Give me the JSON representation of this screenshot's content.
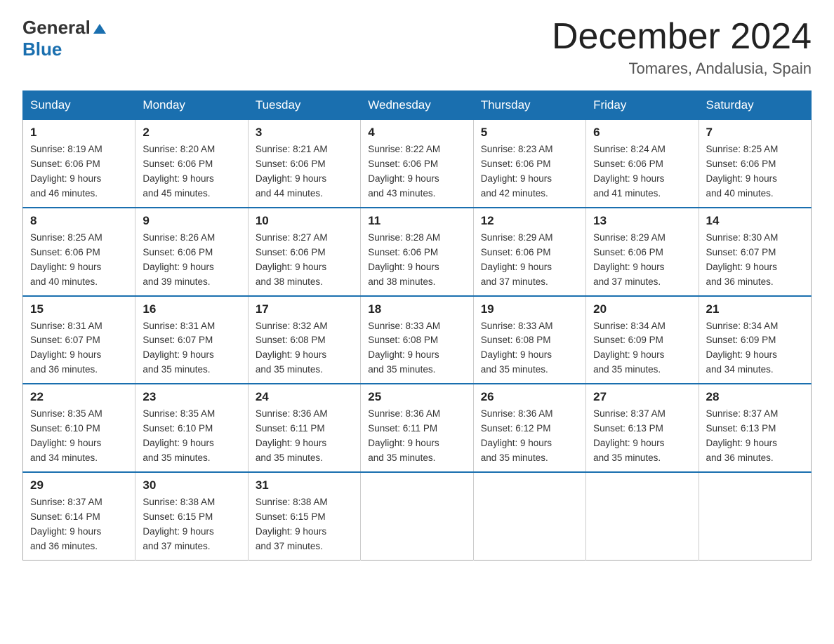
{
  "header": {
    "logo_general": "General",
    "logo_blue": "Blue",
    "month_title": "December 2024",
    "location": "Tomares, Andalusia, Spain"
  },
  "days_of_week": [
    "Sunday",
    "Monday",
    "Tuesday",
    "Wednesday",
    "Thursday",
    "Friday",
    "Saturday"
  ],
  "weeks": [
    [
      {
        "num": "1",
        "sunrise": "8:19 AM",
        "sunset": "6:06 PM",
        "daylight": "9 hours and 46 minutes."
      },
      {
        "num": "2",
        "sunrise": "8:20 AM",
        "sunset": "6:06 PM",
        "daylight": "9 hours and 45 minutes."
      },
      {
        "num": "3",
        "sunrise": "8:21 AM",
        "sunset": "6:06 PM",
        "daylight": "9 hours and 44 minutes."
      },
      {
        "num": "4",
        "sunrise": "8:22 AM",
        "sunset": "6:06 PM",
        "daylight": "9 hours and 43 minutes."
      },
      {
        "num": "5",
        "sunrise": "8:23 AM",
        "sunset": "6:06 PM",
        "daylight": "9 hours and 42 minutes."
      },
      {
        "num": "6",
        "sunrise": "8:24 AM",
        "sunset": "6:06 PM",
        "daylight": "9 hours and 41 minutes."
      },
      {
        "num": "7",
        "sunrise": "8:25 AM",
        "sunset": "6:06 PM",
        "daylight": "9 hours and 40 minutes."
      }
    ],
    [
      {
        "num": "8",
        "sunrise": "8:25 AM",
        "sunset": "6:06 PM",
        "daylight": "9 hours and 40 minutes."
      },
      {
        "num": "9",
        "sunrise": "8:26 AM",
        "sunset": "6:06 PM",
        "daylight": "9 hours and 39 minutes."
      },
      {
        "num": "10",
        "sunrise": "8:27 AM",
        "sunset": "6:06 PM",
        "daylight": "9 hours and 38 minutes."
      },
      {
        "num": "11",
        "sunrise": "8:28 AM",
        "sunset": "6:06 PM",
        "daylight": "9 hours and 38 minutes."
      },
      {
        "num": "12",
        "sunrise": "8:29 AM",
        "sunset": "6:06 PM",
        "daylight": "9 hours and 37 minutes."
      },
      {
        "num": "13",
        "sunrise": "8:29 AM",
        "sunset": "6:06 PM",
        "daylight": "9 hours and 37 minutes."
      },
      {
        "num": "14",
        "sunrise": "8:30 AM",
        "sunset": "6:07 PM",
        "daylight": "9 hours and 36 minutes."
      }
    ],
    [
      {
        "num": "15",
        "sunrise": "8:31 AM",
        "sunset": "6:07 PM",
        "daylight": "9 hours and 36 minutes."
      },
      {
        "num": "16",
        "sunrise": "8:31 AM",
        "sunset": "6:07 PM",
        "daylight": "9 hours and 35 minutes."
      },
      {
        "num": "17",
        "sunrise": "8:32 AM",
        "sunset": "6:08 PM",
        "daylight": "9 hours and 35 minutes."
      },
      {
        "num": "18",
        "sunrise": "8:33 AM",
        "sunset": "6:08 PM",
        "daylight": "9 hours and 35 minutes."
      },
      {
        "num": "19",
        "sunrise": "8:33 AM",
        "sunset": "6:08 PM",
        "daylight": "9 hours and 35 minutes."
      },
      {
        "num": "20",
        "sunrise": "8:34 AM",
        "sunset": "6:09 PM",
        "daylight": "9 hours and 35 minutes."
      },
      {
        "num": "21",
        "sunrise": "8:34 AM",
        "sunset": "6:09 PM",
        "daylight": "9 hours and 34 minutes."
      }
    ],
    [
      {
        "num": "22",
        "sunrise": "8:35 AM",
        "sunset": "6:10 PM",
        "daylight": "9 hours and 34 minutes."
      },
      {
        "num": "23",
        "sunrise": "8:35 AM",
        "sunset": "6:10 PM",
        "daylight": "9 hours and 35 minutes."
      },
      {
        "num": "24",
        "sunrise": "8:36 AM",
        "sunset": "6:11 PM",
        "daylight": "9 hours and 35 minutes."
      },
      {
        "num": "25",
        "sunrise": "8:36 AM",
        "sunset": "6:11 PM",
        "daylight": "9 hours and 35 minutes."
      },
      {
        "num": "26",
        "sunrise": "8:36 AM",
        "sunset": "6:12 PM",
        "daylight": "9 hours and 35 minutes."
      },
      {
        "num": "27",
        "sunrise": "8:37 AM",
        "sunset": "6:13 PM",
        "daylight": "9 hours and 35 minutes."
      },
      {
        "num": "28",
        "sunrise": "8:37 AM",
        "sunset": "6:13 PM",
        "daylight": "9 hours and 36 minutes."
      }
    ],
    [
      {
        "num": "29",
        "sunrise": "8:37 AM",
        "sunset": "6:14 PM",
        "daylight": "9 hours and 36 minutes."
      },
      {
        "num": "30",
        "sunrise": "8:38 AM",
        "sunset": "6:15 PM",
        "daylight": "9 hours and 37 minutes."
      },
      {
        "num": "31",
        "sunrise": "8:38 AM",
        "sunset": "6:15 PM",
        "daylight": "9 hours and 37 minutes."
      },
      null,
      null,
      null,
      null
    ]
  ],
  "labels": {
    "sunrise": "Sunrise: ",
    "sunset": "Sunset: ",
    "daylight": "Daylight: "
  }
}
